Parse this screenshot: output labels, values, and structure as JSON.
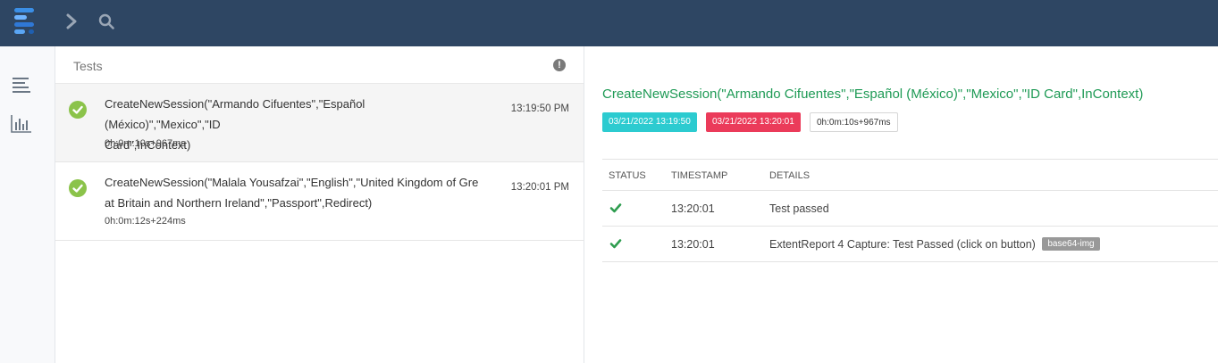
{
  "colors": {
    "topbar": "#2e4663",
    "pass": "#8bc34a",
    "title_green": "#1e9a55",
    "start_badge": "#2ccbd0",
    "end_badge": "#eb3b5a"
  },
  "topbar": {
    "logo_icon": "extent-logo-icon",
    "nav_icons": [
      "chevron-right-icon",
      "search-icon"
    ]
  },
  "sidenav": {
    "items": [
      {
        "icon": "list-icon"
      },
      {
        "icon": "bar-chart-icon"
      }
    ]
  },
  "tests_panel": {
    "title": "Tests",
    "alert_icon": "!",
    "tests": [
      {
        "status": "pass",
        "name_line1": "CreateNewSession(\"Armando Cifuentes\",\"Español (México)\",\"Mexico\",\"ID",
        "name_line2": "Card\",InContext)",
        "duration": "0h:0m:10s+967ms",
        "time": "13:19:50 PM"
      },
      {
        "status": "pass",
        "name_line1": "CreateNewSession(\"Malala Yousafzai\",\"English\",\"United Kingdom of Gre",
        "name_line2": "at Britain and Northern Ireland\",\"Passport\",Redirect)",
        "duration": "0h:0m:12s+224ms",
        "time": "13:20:01 PM"
      }
    ]
  },
  "detail": {
    "title": "CreateNewSession(\"Armando Cifuentes\",\"Español (México)\",\"Mexico\",\"ID Card\",InContext)",
    "start": "03/21/2022 13:19:50",
    "end": "03/21/2022 13:20:01",
    "duration": "0h:0m:10s+967ms",
    "columns": [
      "Status",
      "Timestamp",
      "Details"
    ],
    "logs": [
      {
        "status": "pass",
        "timestamp": "13:20:01",
        "details": "Test passed",
        "badge": ""
      },
      {
        "status": "pass",
        "timestamp": "13:20:01",
        "details": "ExtentReport 4 Capture: Test Passed (click on button)",
        "badge": "base64-img"
      }
    ]
  }
}
